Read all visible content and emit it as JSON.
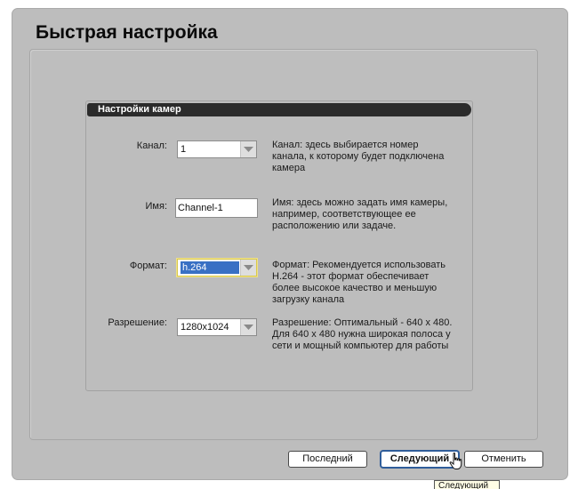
{
  "page": {
    "title": "Быстрая настройка"
  },
  "group": {
    "header": "Настройки камер"
  },
  "fields": {
    "channel": {
      "label": "Канал:",
      "value": "1",
      "desc": [
        "Канал: здесь выбирается номер",
        "канала, к которому будет подключена",
        "камера"
      ]
    },
    "name": {
      "label": "Имя:",
      "value": "Channel-1",
      "desc": [
        "Имя: здесь можно задать имя камеры,",
        "например, соответствующее ее",
        "расположению или задаче."
      ]
    },
    "format": {
      "label": "Формат:",
      "value": "h.264",
      "desc": [
        "Формат: Рекомендуется использовать",
        "H.264 - этот формат обеспечивает",
        "более высокое качество и меньшую",
        "загрузку канала"
      ]
    },
    "resolution": {
      "label": "Разрешение:",
      "value": "1280x1024",
      "desc": [
        "Разрешение: Оптимальный - 640 x 480.",
        "Для 640 x 480 нужна широкая полоса у",
        "сети и мощный компьютер для работы"
      ]
    }
  },
  "buttons": {
    "last": "Последний",
    "next": "Следующий",
    "cancel": "Отменить"
  },
  "tooltip": {
    "text": "Следующий"
  },
  "icons": {
    "dropdown": "chevron-down-icon",
    "cursor": "hand-pointer-icon"
  }
}
